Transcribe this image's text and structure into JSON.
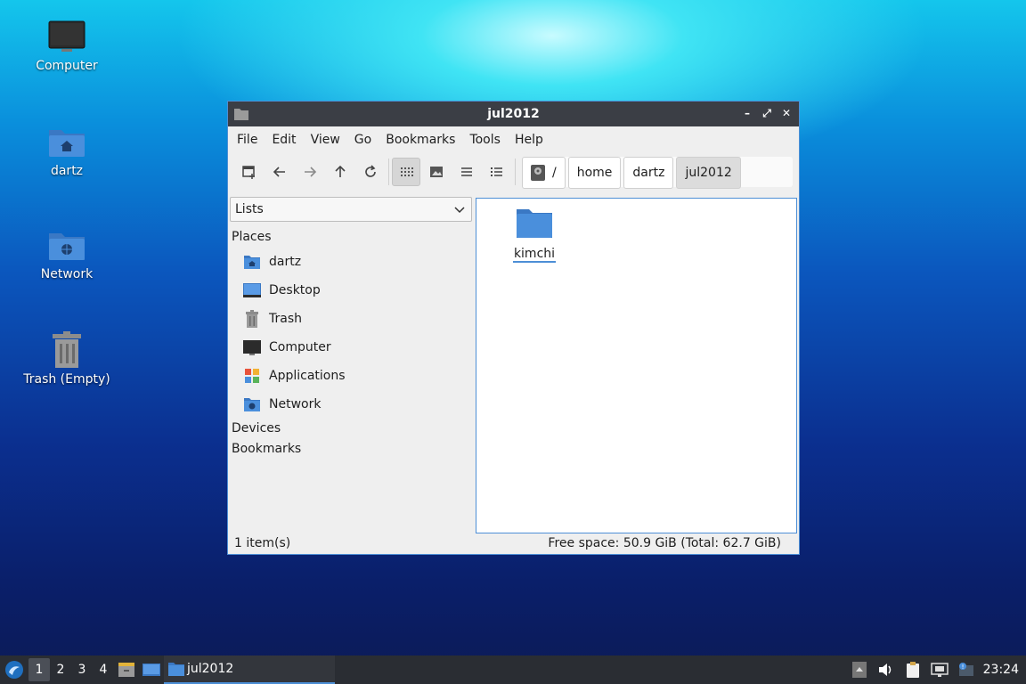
{
  "desktop": {
    "icons": [
      {
        "label": "Computer",
        "icon": "computer-icon"
      },
      {
        "label": "dartz",
        "icon": "home-folder-icon"
      },
      {
        "label": "Network",
        "icon": "network-folder-icon"
      },
      {
        "label": "Trash (Empty)",
        "icon": "trash-icon"
      }
    ]
  },
  "window": {
    "title": "jul2012",
    "controls": {
      "minimize": "–",
      "maximize": "⤢",
      "close": "✕"
    },
    "menu": [
      "File",
      "Edit",
      "View",
      "Go",
      "Bookmarks",
      "Tools",
      "Help"
    ],
    "toolbar": {
      "buttons": [
        "new-tab-icon",
        "back-icon",
        "forward-icon",
        "up-icon",
        "reload-icon",
        "icon-view-icon",
        "thumbnail-view-icon",
        "compact-view-icon",
        "detailed-list-view-icon"
      ],
      "active_view": "icon-view-icon"
    },
    "path": {
      "root": "/",
      "segments": [
        "home",
        "dartz",
        "jul2012"
      ]
    },
    "sidepane": {
      "mode": "Lists",
      "places_label": "Places",
      "places": [
        {
          "label": "dartz",
          "icon": "home-folder-icon"
        },
        {
          "label": "Desktop",
          "icon": "desktop-icon"
        },
        {
          "label": "Trash",
          "icon": "trash-icon"
        },
        {
          "label": "Computer",
          "icon": "computer-icon"
        },
        {
          "label": "Applications",
          "icon": "applications-icon"
        },
        {
          "label": "Network",
          "icon": "network-folder-icon"
        }
      ],
      "devices_label": "Devices",
      "bookmarks_label": "Bookmarks"
    },
    "files": [
      {
        "name": "kimchi",
        "icon": "folder-icon"
      }
    ],
    "status": {
      "count": "1 item(s)",
      "space": "Free space: 50.9 GiB (Total: 62.7 GiB)"
    }
  },
  "taskbar": {
    "workspaces": [
      "1",
      "2",
      "3",
      "4"
    ],
    "active_workspace": "1",
    "task_label": "jul2012",
    "clock": "23:24"
  },
  "colors": {
    "accent": "#4d8fd6",
    "titlebar": "#3b3e45",
    "taskbar": "#2a2d33",
    "folder_blue": "#4a8fdc"
  }
}
